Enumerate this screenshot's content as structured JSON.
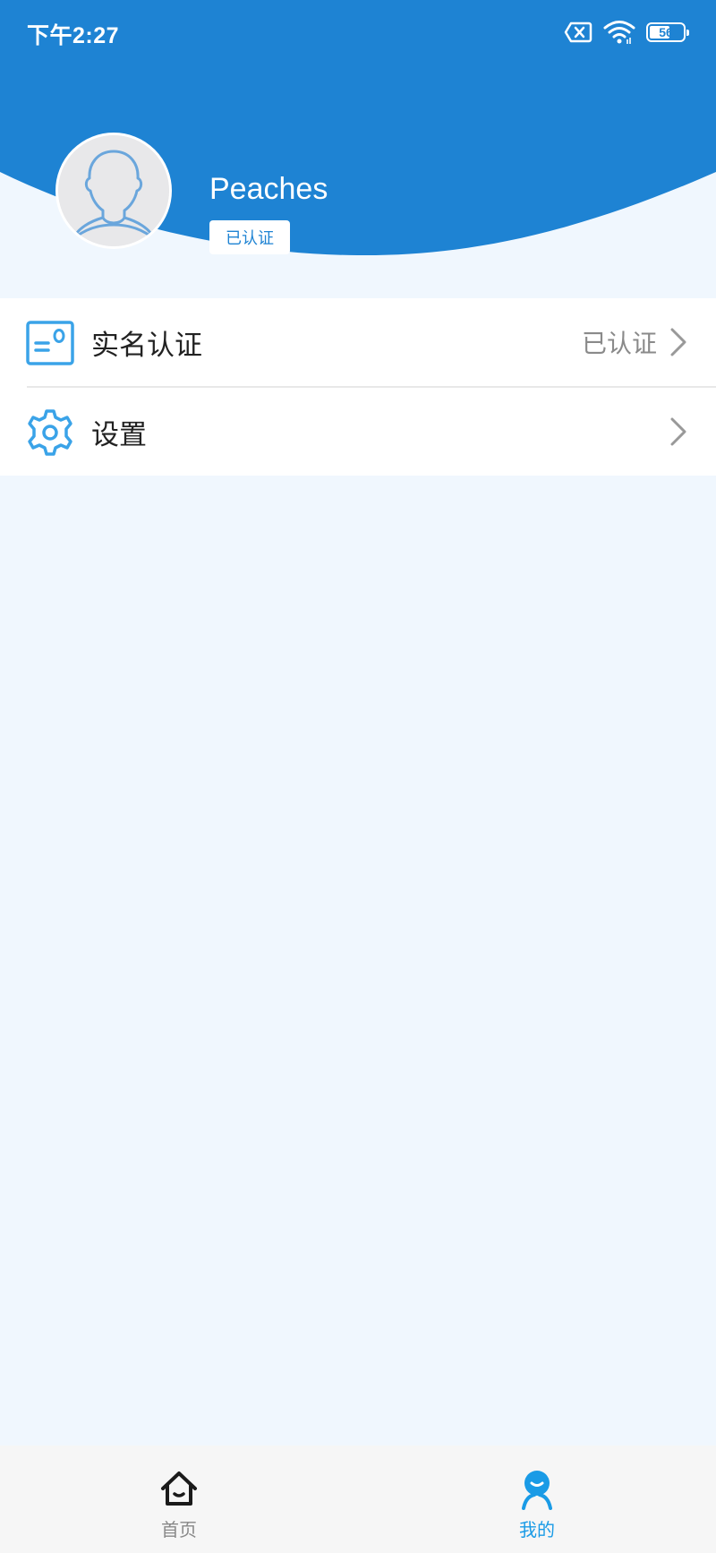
{
  "status_bar": {
    "time": "下午2:27",
    "battery_level": "56",
    "icons": [
      "sim-error-icon",
      "wifi-icon",
      "battery-icon"
    ]
  },
  "profile": {
    "username": "Peaches",
    "verified_tag": "已认证"
  },
  "menu": {
    "items": [
      {
        "label": "实名认证",
        "value": "已认证",
        "icon": "id-card-icon"
      },
      {
        "label": "设置",
        "value": "",
        "icon": "gear-icon"
      }
    ]
  },
  "tabbar": {
    "tabs": [
      {
        "label": "首页",
        "icon": "home-icon",
        "active": false
      },
      {
        "label": "我的",
        "icon": "profile-icon",
        "active": true
      }
    ]
  },
  "colors": {
    "primary": "#1e83d3",
    "accent_icon": "#3aa3e8",
    "background": "#f0f7fe",
    "active_tab": "#1a9be6",
    "inactive_tab": "#888888"
  }
}
